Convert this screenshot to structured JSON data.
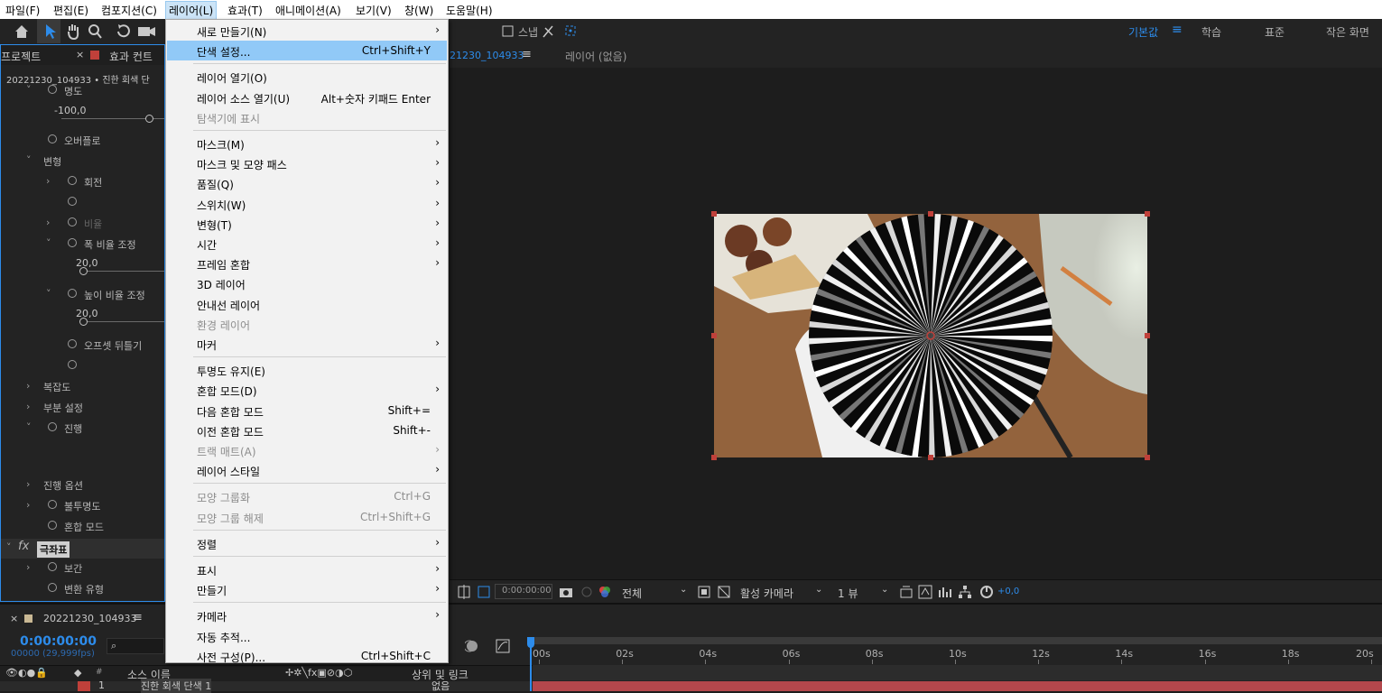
{
  "menubar": [
    "파일(F)",
    "편집(E)",
    "컴포지션(C)",
    "레이어(L)",
    "효과(T)",
    "애니메이션(A)",
    "보기(V)",
    "창(W)",
    "도움말(H)"
  ],
  "toolbar": {
    "snap_label": "스냅",
    "workspaces": [
      "기본값",
      "학습",
      "표준",
      "작은 화면"
    ]
  },
  "left_panel": {
    "tab_project": "프로젝트",
    "tab_effects": "효과 컨트",
    "header": "20221230_104933 • 진한 회색 단",
    "rows": [
      {
        "label": "명도",
        "indent": 2,
        "chevron": "˅",
        "stopwatch": true
      },
      {
        "label": "-100,0",
        "value": true
      },
      {
        "label": "오버플로",
        "indent": 2,
        "stopwatch": true
      },
      {
        "label": "변형",
        "indent": 1,
        "chevron": "˅"
      },
      {
        "label": "회전",
        "indent": 3,
        "chevron": "›",
        "stopwatch": true
      },
      {
        "label": "",
        "indent": 3,
        "stopwatch": true
      },
      {
        "label": "비율",
        "indent": 3,
        "chevron": "›",
        "stopwatch": true,
        "dim": true
      },
      {
        "label": "폭 비율 조정",
        "indent": 3,
        "chevron": "˅",
        "stopwatch": true
      },
      {
        "label": "20,0",
        "value": true
      },
      {
        "label": "높이 비율 조정",
        "indent": 3,
        "chevron": "˅",
        "stopwatch": true
      },
      {
        "label": "20,0",
        "value": true
      },
      {
        "label": "오프셋 뒤틀기",
        "indent": 3,
        "stopwatch": true
      },
      {
        "label": "",
        "indent": 3,
        "stopwatch": true
      },
      {
        "label": "복잡도",
        "indent": 1,
        "chevron": "›"
      },
      {
        "label": "부분 설정",
        "indent": 1,
        "chevron": "›"
      },
      {
        "label": "진행",
        "indent": 1,
        "chevron": "˅",
        "stopwatch": true
      },
      {
        "label": "진행 옵션",
        "indent": 1,
        "chevron": "›"
      },
      {
        "label": "불투명도",
        "indent": 1,
        "chevron": "›",
        "stopwatch": true
      },
      {
        "label": "혼합 모드",
        "indent": 1,
        "stopwatch": true
      },
      {
        "label": "극좌표",
        "fx": true
      },
      {
        "label": "보간",
        "indent": 1,
        "chevron": "›",
        "stopwatch": true
      },
      {
        "label": "변환 유형",
        "indent": 1,
        "stopwatch": true
      }
    ]
  },
  "comp": {
    "tab": "21230_104933",
    "layer_tab": "레이어 (없음)",
    "timecode": "0:00:00:00",
    "resolution": "전체",
    "camera": "활성 카메라",
    "views": "1 뷰",
    "exposure": "+0,0"
  },
  "timeline": {
    "comp_name": "20221230_104933",
    "timecode": "0:00:00:00",
    "fps": "00000 (29,999fps)",
    "col_source": "소스 이름",
    "col_parent": "상위 및 링크",
    "layer_index": "1",
    "layer_name": "진한 회색 단색 1",
    "layer_parent": "없음",
    "ruler": [
      "00s",
      "02s",
      "04s",
      "06s",
      "08s",
      "10s",
      "12s",
      "14s",
      "16s",
      "18s",
      "20s"
    ]
  },
  "layer_menu": {
    "items": [
      {
        "label": "새로 만들기(N)",
        "submenu": true
      },
      {
        "label": "단색 설정...",
        "shortcut": "Ctrl+Shift+Y",
        "highlighted": true
      },
      {
        "sep": true
      },
      {
        "label": "레이어 열기(O)"
      },
      {
        "label": "레이어 소스 열기(U)",
        "shortcut": "Alt+숫자 키패드 Enter"
      },
      {
        "label": "탐색기에 표시",
        "disabled": true
      },
      {
        "sep": true
      },
      {
        "label": "마스크(M)",
        "submenu": true
      },
      {
        "label": "마스크 및 모양 패스",
        "submenu": true
      },
      {
        "label": "품질(Q)",
        "submenu": true
      },
      {
        "label": "스위치(W)",
        "submenu": true
      },
      {
        "label": "변형(T)",
        "submenu": true
      },
      {
        "label": "시간",
        "submenu": true
      },
      {
        "label": "프레임 혼합",
        "submenu": true
      },
      {
        "label": "3D 레이어"
      },
      {
        "label": "안내선 레이어"
      },
      {
        "label": "환경 레이어",
        "disabled": true
      },
      {
        "label": "마커",
        "submenu": true
      },
      {
        "sep": true
      },
      {
        "label": "투명도 유지(E)"
      },
      {
        "label": "혼합 모드(D)",
        "submenu": true
      },
      {
        "label": "다음 혼합 모드",
        "shortcut": "Shift+="
      },
      {
        "label": "이전 혼합 모드",
        "shortcut": "Shift+-"
      },
      {
        "label": "트랙 매트(A)",
        "submenu": true,
        "disabled": true
      },
      {
        "label": "레이어 스타일",
        "submenu": true
      },
      {
        "sep": true
      },
      {
        "label": "모양 그룹화",
        "shortcut": "Ctrl+G",
        "disabled": true
      },
      {
        "label": "모양 그룹 해제",
        "shortcut": "Ctrl+Shift+G",
        "disabled": true
      },
      {
        "sep": true
      },
      {
        "label": "정렬",
        "submenu": true
      },
      {
        "sep": true
      },
      {
        "label": "표시",
        "submenu": true
      },
      {
        "label": "만들기",
        "submenu": true
      },
      {
        "sep": true
      },
      {
        "label": "카메라",
        "submenu": true
      },
      {
        "label": "자동 추적..."
      },
      {
        "label": "사전 구성(P)...",
        "shortcut": "Ctrl+Shift+C"
      }
    ]
  },
  "colors": {
    "accent": "#2d8ceb",
    "highlight": "#91c9f7",
    "handle": "#c0403a",
    "track": "#c05055"
  }
}
